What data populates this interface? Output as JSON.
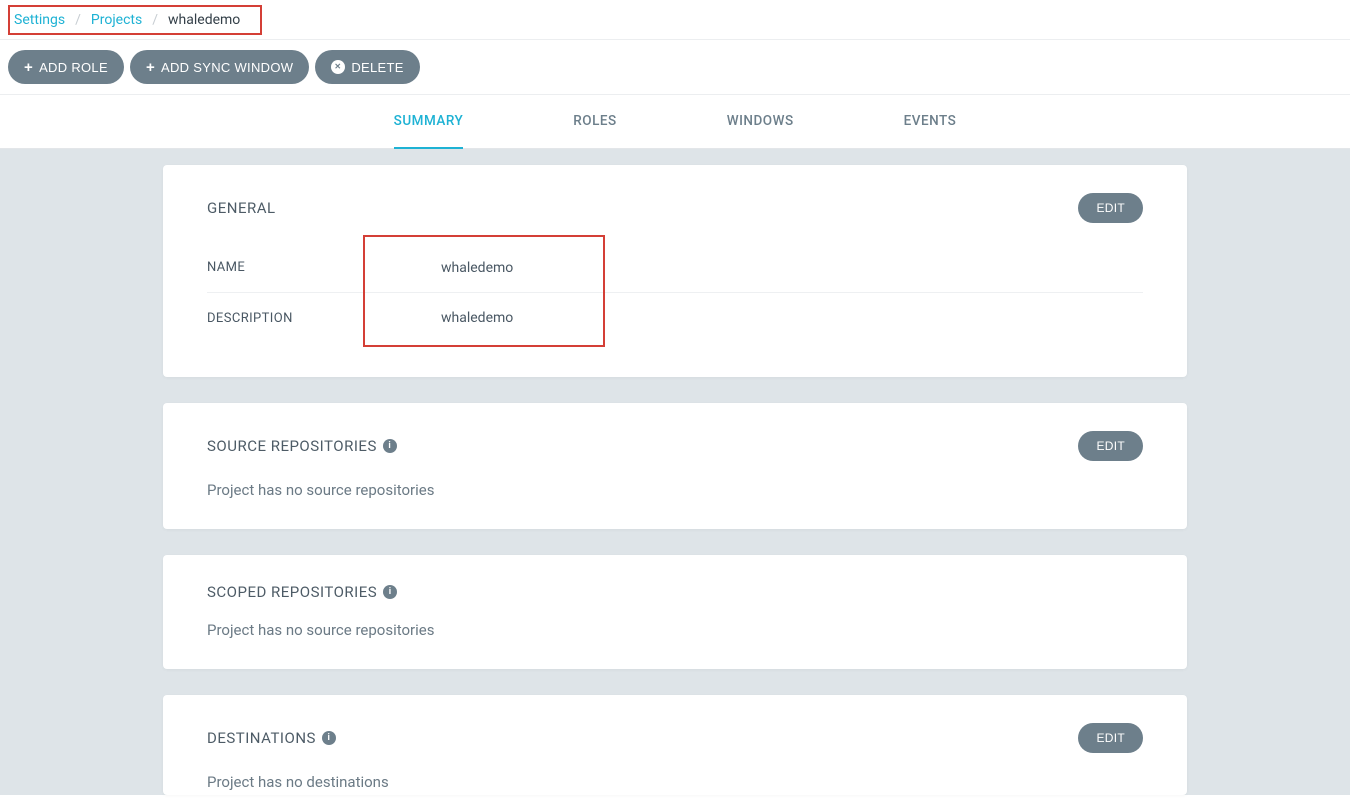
{
  "breadcrumb": {
    "settings": "Settings",
    "projects": "Projects",
    "current": "whaledemo"
  },
  "toolbar": {
    "add_role": "ADD ROLE",
    "add_sync_window": "ADD SYNC WINDOW",
    "delete": "DELETE"
  },
  "tabs": {
    "summary": "SUMMARY",
    "roles": "ROLES",
    "windows": "WINDOWS",
    "events": "EVENTS"
  },
  "general": {
    "title": "GENERAL",
    "edit": "EDIT",
    "name_label": "NAME",
    "name_value": "whaledemo",
    "desc_label": "DESCRIPTION",
    "desc_value": "whaledemo"
  },
  "source_repos": {
    "title": "SOURCE REPOSITORIES",
    "edit": "EDIT",
    "empty": "Project has no source repositories"
  },
  "scoped_repos": {
    "title": "SCOPED REPOSITORIES",
    "empty": "Project has no source repositories"
  },
  "destinations": {
    "title": "DESTINATIONS",
    "edit": "EDIT",
    "empty": "Project has no destinations"
  }
}
